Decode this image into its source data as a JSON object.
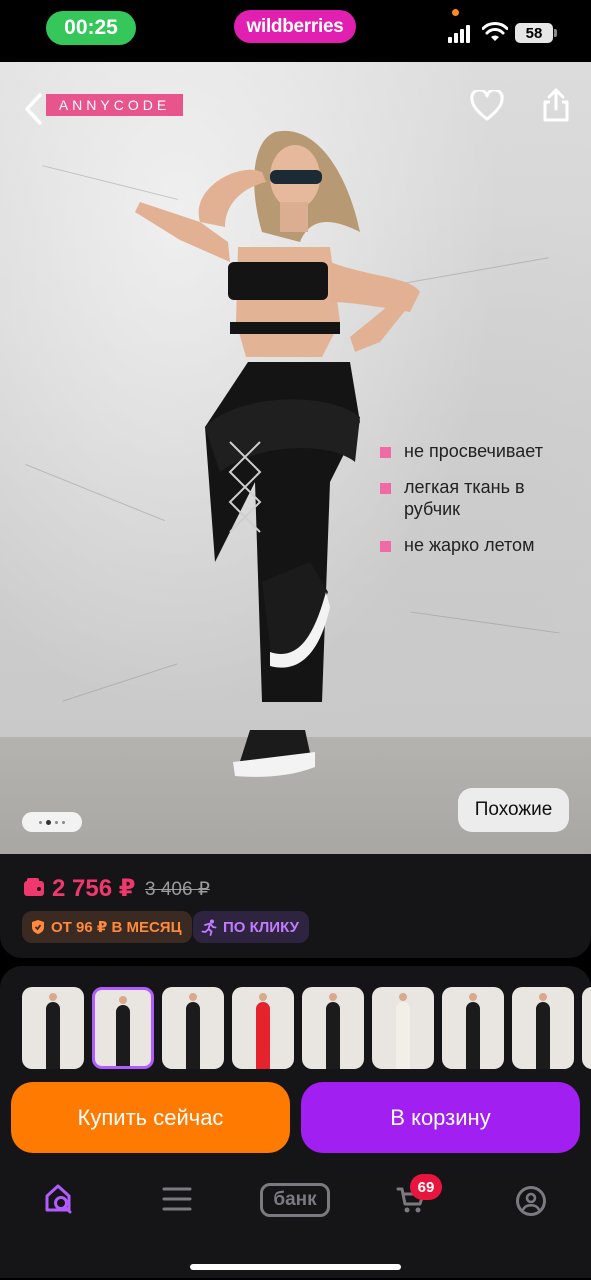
{
  "status_bar": {
    "time": "00:25",
    "brand": "wildberries",
    "battery": "58"
  },
  "product": {
    "brand_tag": "ANNYCODE",
    "features": [
      "не просвечивает",
      "легкая ткань в рубчик",
      "не жарко летом"
    ],
    "image_page": 2,
    "image_count": 4,
    "similar_label": "Похожие"
  },
  "price": {
    "current": "2 756 ₽",
    "old": "3 406 ₽",
    "installment": "ОТ 96 ₽ В МЕСЯЦ",
    "oneclick": "ПО КЛИКУ"
  },
  "variants": {
    "selected_index": 1,
    "colors": [
      "#1b1b1b",
      "#1b1b1b",
      "#1b1b1b",
      "#e5232c",
      "#1b1b1b",
      "#f2efe9",
      "#1b1b1b",
      "#1b1b1b",
      "#1b1b1b"
    ]
  },
  "actions": {
    "buy_now": "Купить сейчас",
    "add_to_cart": "В корзину"
  },
  "nav": {
    "bank_label": "банк",
    "cart_count": "69",
    "active": "home"
  },
  "colors": {
    "price": "#f0386e",
    "buy_now": "#ff7a00",
    "add_to_cart": "#a11ff1",
    "brand": "#e11fb0"
  }
}
